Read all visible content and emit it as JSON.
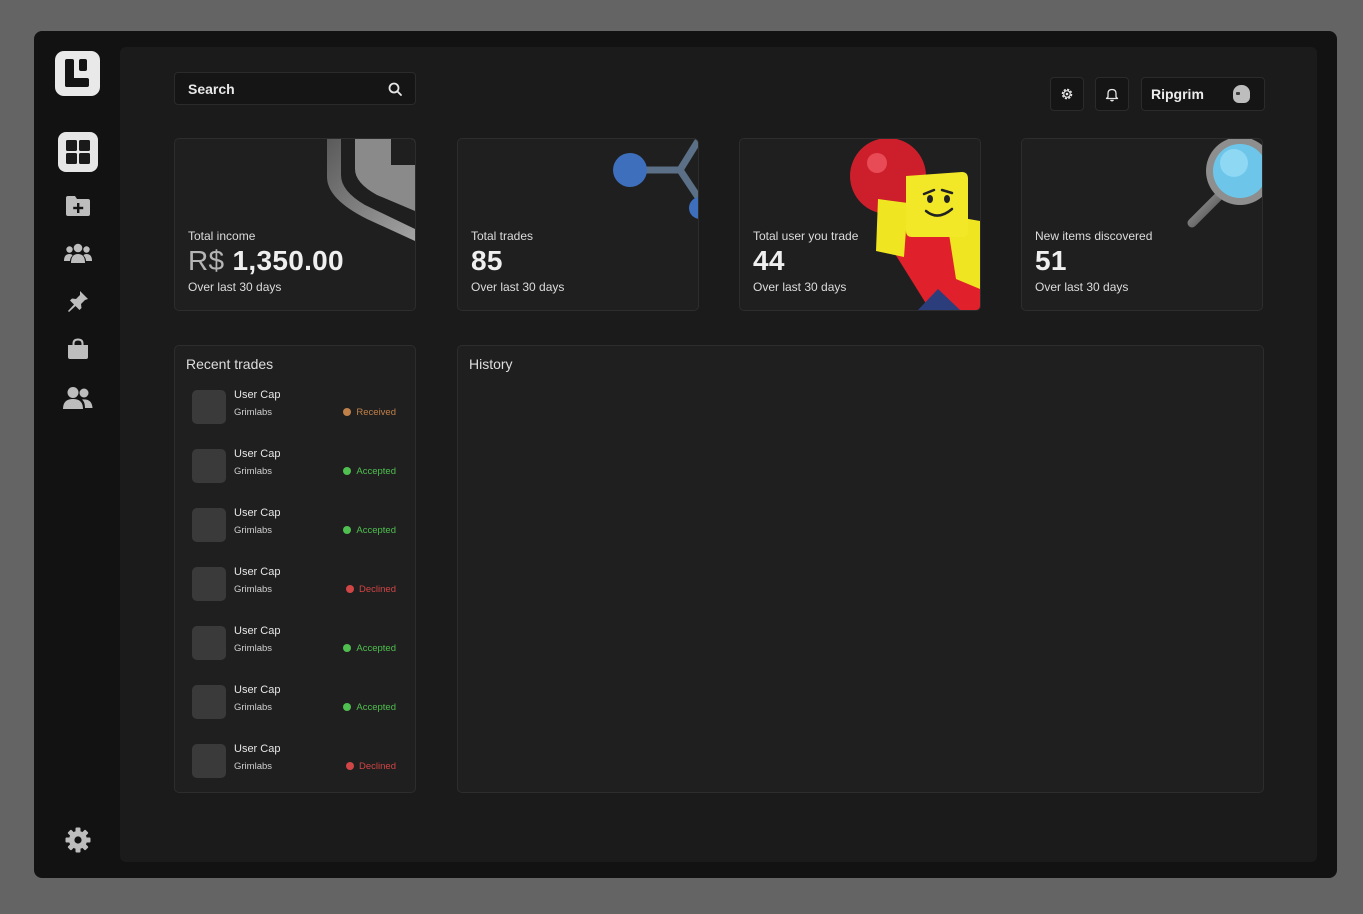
{
  "search": {
    "placeholder": "Search"
  },
  "user": {
    "name": "Ripgrim"
  },
  "sidebar": {
    "items": [
      {
        "icon": "dashboard-grid-icon",
        "active": true
      },
      {
        "icon": "folder-plus-icon",
        "active": false
      },
      {
        "icon": "users-group-icon",
        "active": false
      },
      {
        "icon": "pin-icon",
        "active": false
      },
      {
        "icon": "shopping-bag-icon",
        "active": false
      },
      {
        "icon": "user-friends-icon",
        "active": false
      }
    ],
    "footer_icon": "gear-icon"
  },
  "stats": [
    {
      "label": "Total income",
      "currency": "R$",
      "value": "1,350.00",
      "sub": "Over last 30 days",
      "art": "shield-art"
    },
    {
      "label": "Total trades",
      "value": "85",
      "sub": "Over last 30 days",
      "art": "nodes-art"
    },
    {
      "label": "Total user you trade",
      "value": "44",
      "sub": "Over last 30 days",
      "art": "character-balloon-art"
    },
    {
      "label": "New items discovered",
      "value": "51",
      "sub": "Over last 30 days",
      "art": "magnifier-art"
    }
  ],
  "recent": {
    "title": "Recent trades",
    "items": [
      {
        "name": "User Cap",
        "user": "Grimlabs",
        "status": "Received",
        "color": "#c0804a"
      },
      {
        "name": "User Cap",
        "user": "Grimlabs",
        "status": "Accepted",
        "color": "#4fbf4f"
      },
      {
        "name": "User Cap",
        "user": "Grimlabs",
        "status": "Accepted",
        "color": "#4fbf4f"
      },
      {
        "name": "User Cap",
        "user": "Grimlabs",
        "status": "Declined",
        "color": "#d04545"
      },
      {
        "name": "User Cap",
        "user": "Grimlabs",
        "status": "Accepted",
        "color": "#4fbf4f"
      },
      {
        "name": "User Cap",
        "user": "Grimlabs",
        "status": "Accepted",
        "color": "#4fbf4f"
      },
      {
        "name": "User Cap",
        "user": "Grimlabs",
        "status": "Declined",
        "color": "#d04545"
      }
    ]
  },
  "history": {
    "title": "History"
  }
}
